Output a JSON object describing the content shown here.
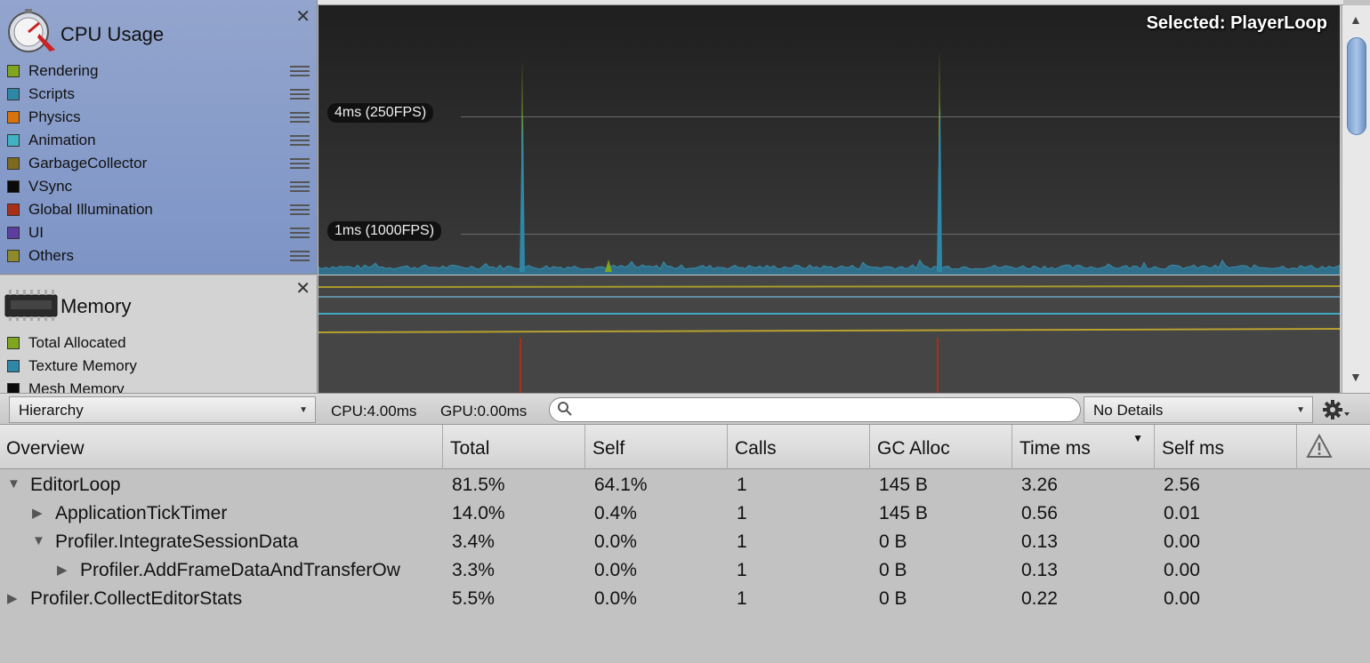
{
  "cpu_module": {
    "title": "CPU Usage",
    "close_label": "✕",
    "legend": [
      {
        "label": "Rendering",
        "color": "#7fa61e"
      },
      {
        "label": "Scripts",
        "color": "#2f87a8"
      },
      {
        "label": "Physics",
        "color": "#d9730d"
      },
      {
        "label": "Animation",
        "color": "#3fb3c4"
      },
      {
        "label": "GarbageCollector",
        "color": "#7d6a1e"
      },
      {
        "label": "VSync",
        "color": "#0a0a0a"
      },
      {
        "label": "Global Illumination",
        "color": "#a83019"
      },
      {
        "label": "UI",
        "color": "#5b3ea0"
      },
      {
        "label": "Others",
        "color": "#8c8a2a"
      }
    ]
  },
  "memory_module": {
    "title": "Memory",
    "close_label": "✕",
    "legend": [
      {
        "label": "Total Allocated",
        "color": "#7fa61e"
      },
      {
        "label": "Texture Memory",
        "color": "#2f87a8"
      },
      {
        "label": "Mesh Memory",
        "color": "#0a0a0a"
      }
    ]
  },
  "graph": {
    "selected_label": "Selected: PlayerLoop",
    "fps_markers": [
      "4ms (250FPS)",
      "1ms (1000FPS)"
    ]
  },
  "toolbar": {
    "view_mode": "Hierarchy",
    "cpu_time": "CPU:4.00ms",
    "gpu_time": "GPU:0.00ms",
    "search_placeholder": "",
    "details_mode": "No Details"
  },
  "table": {
    "columns": [
      "Overview",
      "Total",
      "Self",
      "Calls",
      "GC Alloc",
      "Time ms",
      "Self ms"
    ],
    "rows": [
      {
        "name": "EditorLoop",
        "depth": 0,
        "expanded": true,
        "total": "81.5%",
        "self": "64.1%",
        "calls": "1",
        "gc": "145 B",
        "time": "3.26",
        "selfms": "2.56"
      },
      {
        "name": "ApplicationTickTimer",
        "depth": 1,
        "expanded": false,
        "total": "14.0%",
        "self": "0.4%",
        "calls": "1",
        "gc": "145 B",
        "time": "0.56",
        "selfms": "0.01"
      },
      {
        "name": "Profiler.IntegrateSessionData",
        "depth": 1,
        "expanded": true,
        "total": "3.4%",
        "self": "0.0%",
        "calls": "1",
        "gc": "0 B",
        "time": "0.13",
        "selfms": "0.00"
      },
      {
        "name": "Profiler.AddFrameDataAndTransferOw",
        "depth": 2,
        "expanded": false,
        "total": "3.3%",
        "self": "0.0%",
        "calls": "1",
        "gc": "0 B",
        "time": "0.13",
        "selfms": "0.00"
      },
      {
        "name": "Profiler.CollectEditorStats",
        "depth": 0,
        "expanded": false,
        "total": "5.5%",
        "self": "0.0%",
        "calls": "1",
        "gc": "0 B",
        "time": "0.22",
        "selfms": "0.00"
      }
    ]
  }
}
